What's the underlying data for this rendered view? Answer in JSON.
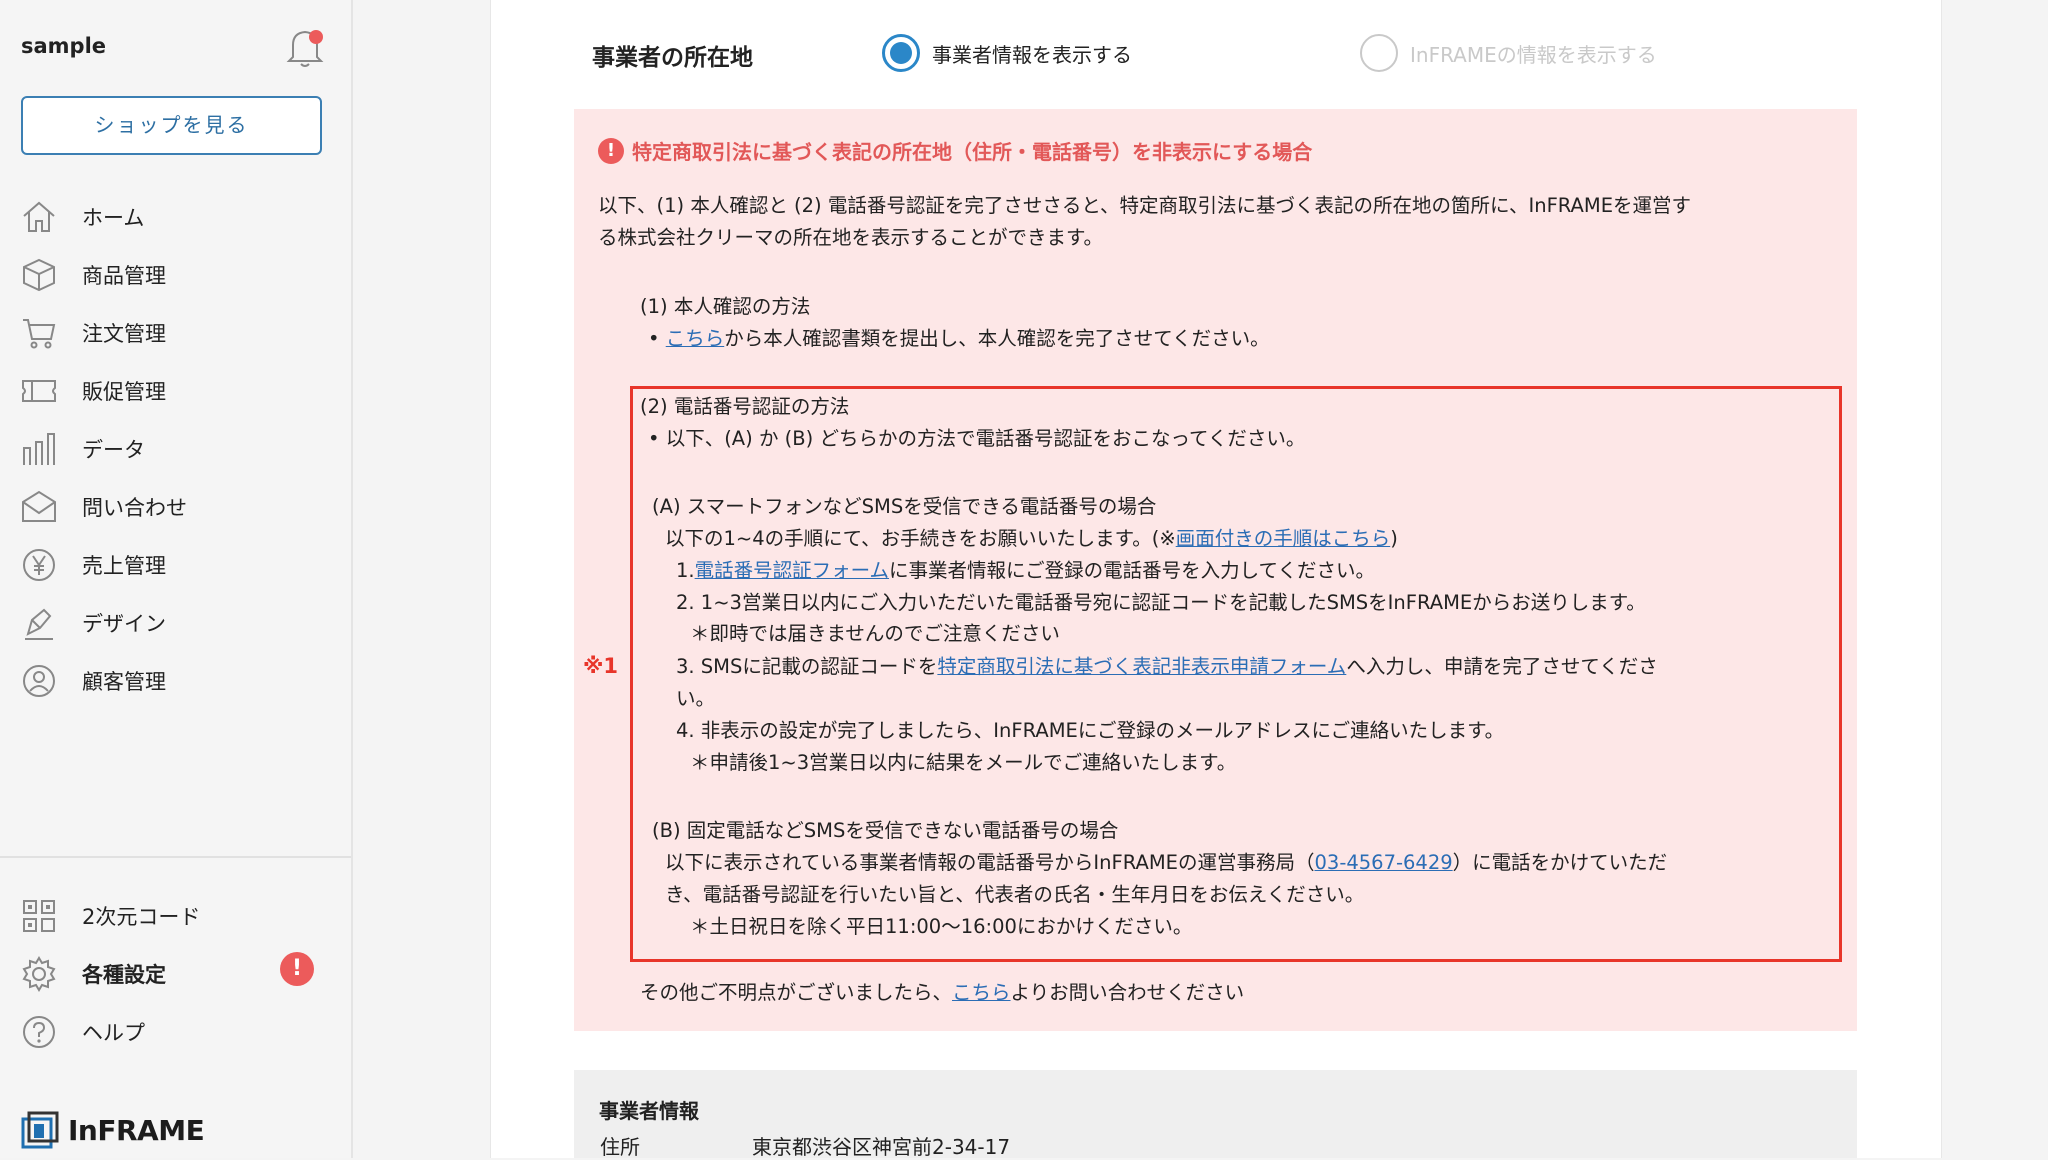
{
  "sidebar": {
    "shop_name": "sample",
    "shop_button": "ショップを見る",
    "nav": [
      {
        "label": "ホーム",
        "icon": "home-icon"
      },
      {
        "label": "商品管理",
        "icon": "box-icon"
      },
      {
        "label": "注文管理",
        "icon": "cart-icon"
      },
      {
        "label": "販促管理",
        "icon": "ticket-icon"
      },
      {
        "label": "データ",
        "icon": "bar-chart-icon"
      },
      {
        "label": "問い合わせ",
        "icon": "mail-icon"
      },
      {
        "label": "売上管理",
        "icon": "yen-icon"
      },
      {
        "label": "デザイン",
        "icon": "pen-icon"
      },
      {
        "label": "顧客管理",
        "icon": "user-icon"
      }
    ],
    "bottom_nav": [
      {
        "label": "2次元コード",
        "icon": "qr-icon"
      },
      {
        "label": "各種設定",
        "icon": "gear-icon"
      },
      {
        "label": "ヘルプ",
        "icon": "help-icon"
      }
    ],
    "alert_badge": "!",
    "logo_text": "InFRAME"
  },
  "location": {
    "heading": "事業者の所在地",
    "option_own": "事業者情報を表示する",
    "option_inframe": "InFRAMEの情報を表示する"
  },
  "notice": {
    "title": "特定商取引法に基づく表記の所在地（住所・電話番号）を非表示にする場合",
    "intro_1": "以下、(1) 本人確認と (2) 電話番号認証を完了させさると、特定商取引法に基づく表記の所在地の箇所に、InFRAMEを運営す",
    "intro_2": "る株式会社クリーマの所在地を表示することができます。",
    "s1_title": "(1) 本人確認の方法",
    "s1_bullet": "•",
    "s1_link": "こちら",
    "s1_text": "から本人確認書類を提出し、本人確認を完了させてください。",
    "s2_title": "(2) 電話番号認証の方法",
    "s2_intro": "• 以下、(A) か (B) どちらかの方法で電話番号認証をおこなってください。",
    "a_title": "(A) スマートフォンなどSMSを受信できる電話番号の場合",
    "a_intro_pre": "以下の1~4の手順にて、お手続きをお願いいたします。(※",
    "a_intro_link": "画面付きの手順はこちら",
    "a_intro_post": ")",
    "a_step1_num": "1.",
    "a_step1_link": "電話番号認証フォーム",
    "a_step1_text": "に事業者情報にご登録の電話番号を入力してください。",
    "a_step2": "2. 1~3営業日以内にご入力いただいた電話番号宛に認証コードを記載したSMSをInFRAMEからお送りします。",
    "a_step2_note": "＊即時では届きませんのでご注意ください",
    "a_step3_pre": "3. SMSに記載の認証コードを",
    "a_step3_link": "特定商取引法に基づく表記非表示申請フォーム",
    "a_step3_post": "へ入力し、申請を完了させてくださ",
    "a_step3_cont": "い。",
    "a_step4": "4. 非表示の設定が完了しましたら、InFRAMEにご登録のメールアドレスにご連絡いたします。",
    "a_step4_note": "＊申請後1~3営業日以内に結果をメールでご連絡いたします。",
    "b_title": "(B) 固定電話などSMSを受信できない電話番号の場合",
    "b_text1_pre": "以下に表示されている事業者情報の電話番号からInFRAMEの運営事務局（",
    "b_phone": "03-4567-6429",
    "b_text1_post": "）に電話をかけていただ",
    "b_text2": "き、電話番号認証を行いたい旨と、代表者の氏名・生年月日をお伝えください。",
    "b_note": "＊土日祝日を除く平日11:00〜16:00におかけください。",
    "note_mark": "※1",
    "footer_pre": "その他ご不明点がございましたら、",
    "footer_link": "こちら",
    "footer_post": "よりお問い合わせください"
  },
  "business_info": {
    "title": "事業者情報",
    "address_label": "住所",
    "address_value": "東京都渋谷区神宮前2-34-17"
  },
  "colors": {
    "accent": "#2b87c8",
    "link": "#2b6db5",
    "warning_bg": "#fde7e7",
    "warning_text": "#e25858",
    "highlight_border": "#e8352a"
  }
}
